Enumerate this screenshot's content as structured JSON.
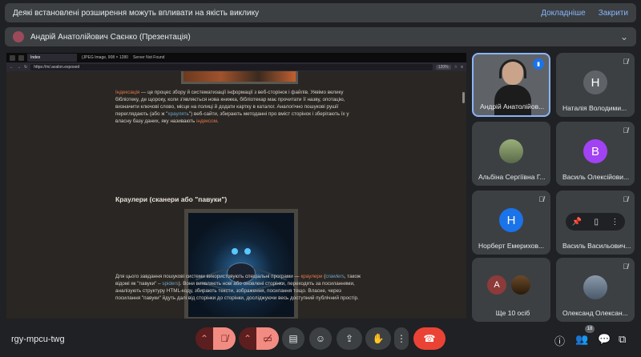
{
  "banner": {
    "message": "Деякі встановлені розширення можуть впливати на якість виклику",
    "details_label": "Докладніше",
    "close_label": "Закрити"
  },
  "presenter": {
    "label": "Андрій Анатолійович Саєнко (Презентація)"
  },
  "shared_browser": {
    "tabs": [
      "Index",
      "(JPEG Image, 908 × 1280 pi",
      "Server Not Found"
    ],
    "url": "https://m/.avalon.exposed",
    "zoom": "120%"
  },
  "shared_page": {
    "para1_term": "Індексація",
    "para1_text": " — це процес збору й систематизації інформації з веб-сторінок і файлів. Уявімо велику бібліотеку, де щороку, коли з'являється нова книжка, бібліотекар має прочитати її назву, опотацію, визначити ключові слово, місце на полиці й додати картку в каталог. Аналогічно пошукові рушії переглядають (або ж \"",
    "para1_link": "храулять",
    "para1_text2": "\") веб-сайти, збирають методанні про вміст сторінок і зберігають їх у власну базу даних, яку називають ",
    "para1_term2": "індексом",
    "heading": "Краулери (сканери або \"павуки\")",
    "para2_text": "Для цього завдання пошукові системи використовують спеціальні програми — ",
    "para2_term": "краулери",
    "para2_link1": "crawlers",
    "para2_mid": ", також відомі як \"павуки\" – ",
    "para2_link2": "spiders",
    "para2_rest": "). Вони виявляють нові або оновлені сторінки, переходять за посиланнями, аналізують структуру HTML-коду, збирають тексти, зображення, посилання тощо. Власне, через посилання \"павуки\" йдуть далі від сторінки до сторінки, досліджуючи весь доступний публічний простір."
  },
  "participants": [
    {
      "name": "Андрій Анатолійов...",
      "initial": "",
      "color": "",
      "speaking": true
    },
    {
      "name": "Наталія Володими...",
      "initial": "Н",
      "color": "#5f6368"
    },
    {
      "name": "Альбіна Сергіївна Г...",
      "initial": "",
      "color": "#7a8a5a"
    },
    {
      "name": "Василь Олексійови...",
      "initial": "В",
      "color": "#a142f4"
    },
    {
      "name": "Норберт Емерихов...",
      "initial": "Н",
      "color": "#1a73e8"
    },
    {
      "name": "Василь Васильович...",
      "initial": "",
      "color": ""
    },
    {
      "name": "Ще 10 осіб",
      "initial": "А",
      "color": "#8d3a3a"
    },
    {
      "name": "Олександ Олексан...",
      "initial": "",
      "color": "#6b7b8b"
    }
  ],
  "bottom": {
    "meeting_code": "rgy-mpcu-twg",
    "participant_count": "18"
  }
}
